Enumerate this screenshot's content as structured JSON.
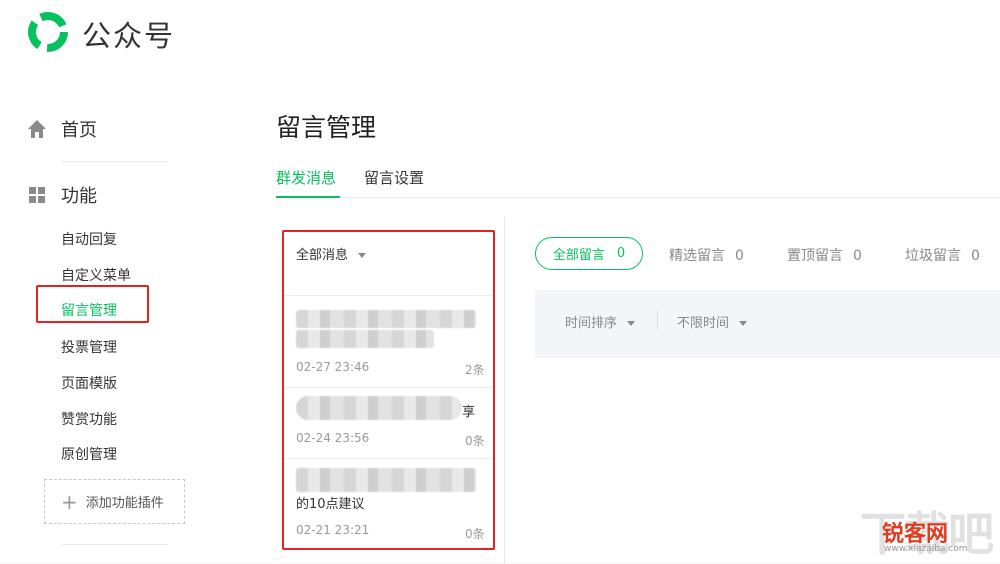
{
  "header": {
    "brand": "公众号",
    "logo_icon": "wechat-official-accounts-logo-icon",
    "accent": "#07c160"
  },
  "sidebar": {
    "home": {
      "label": "首页",
      "icon": "home-icon"
    },
    "features": {
      "label": "功能",
      "icon": "grid-icon"
    },
    "items": [
      {
        "label": "自动回复"
      },
      {
        "label": "自定义菜单"
      },
      {
        "label": "留言管理",
        "active": true
      },
      {
        "label": "投票管理"
      },
      {
        "label": "页面模版"
      },
      {
        "label": "赞赏功能"
      },
      {
        "label": "原创管理"
      }
    ],
    "add_plugin": "添加功能插件"
  },
  "page": {
    "title": "留言管理",
    "tabs": [
      {
        "label": "群发消息",
        "active": true
      },
      {
        "label": "留言设置"
      }
    ]
  },
  "message_list": {
    "filter": "全部消息",
    "items": [
      {
        "text": "",
        "date": "02-27 23:46",
        "count": "2条"
      },
      {
        "text_suffix": "享",
        "date": "02-24 23:56",
        "count": "0条"
      },
      {
        "text": "的10点建议",
        "date": "02-21 23:21",
        "count": "0条"
      }
    ]
  },
  "comments": {
    "filters": [
      {
        "label": "全部留言",
        "count": "0",
        "active": true
      },
      {
        "label": "精选留言",
        "count": "0"
      },
      {
        "label": "置顶留言",
        "count": "0"
      },
      {
        "label": "垃圾留言",
        "count": "0"
      }
    ],
    "sort": {
      "order": "时间排序",
      "time": "不限时间"
    }
  },
  "watermark": {
    "big": "下载吧",
    "site": "锐客网",
    "url": "www.xiazaiba.com"
  },
  "colors": {
    "highlight_box": "#e02424"
  }
}
